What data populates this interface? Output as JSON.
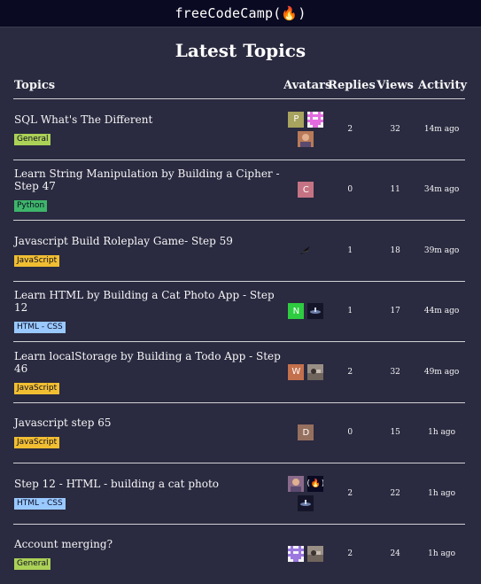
{
  "header": {
    "brand": "freeCodeCamp(🔥)"
  },
  "page": {
    "title": "Latest Topics"
  },
  "table": {
    "columns": {
      "topics": "Topics",
      "avatars": "Avatars",
      "replies": "Replies",
      "views": "Views",
      "activity": "Activity"
    },
    "rows": [
      {
        "title": "SQL What's The Different",
        "category": "General",
        "category_color": "#acd157",
        "replies": "2",
        "views": "32",
        "activity": "14m ago",
        "avatars": [
          {
            "type": "letter",
            "letter": "P",
            "color": "#a8a35e"
          },
          {
            "type": "pixel",
            "color": "#e36be0"
          },
          {
            "type": "photo",
            "color": "#b87a58"
          }
        ]
      },
      {
        "title": "Learn String Manipulation by Building a Cipher - Step 47",
        "category": "Python",
        "category_color": "#3eb56a",
        "replies": "0",
        "views": "11",
        "activity": "34m ago",
        "avatars": [
          {
            "type": "letter",
            "letter": "C",
            "color": "#c57384"
          }
        ]
      },
      {
        "title": "Javascript Build Roleplay Game- Step 59",
        "category": "JavaScript",
        "category_color": "#f1be32",
        "replies": "1",
        "views": "18",
        "activity": "39m ago",
        "avatars": [
          {
            "type": "drawing",
            "color": "#2a2a40"
          }
        ]
      },
      {
        "title": "Learn HTML by Building a Cat Photo App - Step 12",
        "category": "HTML - CSS",
        "category_color": "#99c9ff",
        "replies": "1",
        "views": "17",
        "activity": "44m ago",
        "avatars": [
          {
            "type": "letter",
            "letter": "N",
            "color": "#2ecc40"
          },
          {
            "type": "photo-dark",
            "color": "#1b1b32"
          }
        ]
      },
      {
        "title": "Learn localStorage by Building a Todo App - Step 46",
        "category": "JavaScript",
        "category_color": "#f1be32",
        "replies": "2",
        "views": "32",
        "activity": "49m ago",
        "avatars": [
          {
            "type": "letter",
            "letter": "W",
            "color": "#c4704c"
          },
          {
            "type": "photo-gray",
            "color": "#857a70"
          }
        ]
      },
      {
        "title": "Javascript step 65",
        "category": "JavaScript",
        "category_color": "#f1be32",
        "replies": "0",
        "views": "15",
        "activity": "1h ago",
        "avatars": [
          {
            "type": "letter",
            "letter": "D",
            "color": "#96705f"
          }
        ]
      },
      {
        "title": "Step 12 - HTML - building a cat photo",
        "category": "HTML - CSS",
        "category_color": "#99c9ff",
        "replies": "2",
        "views": "22",
        "activity": "1h ago",
        "avatars": [
          {
            "type": "photo",
            "color": "#8a6a8a"
          },
          {
            "type": "fcc",
            "color": "#0a0a23"
          },
          {
            "type": "photo-dark",
            "color": "#1b1b32"
          }
        ]
      },
      {
        "title": "Account merging?",
        "category": "General",
        "category_color": "#acd157",
        "replies": "2",
        "views": "24",
        "activity": "1h ago",
        "avatars": [
          {
            "type": "pixel-purple",
            "color": "#9b78e0"
          },
          {
            "type": "photo-gray",
            "color": "#857a70"
          }
        ]
      }
    ]
  }
}
